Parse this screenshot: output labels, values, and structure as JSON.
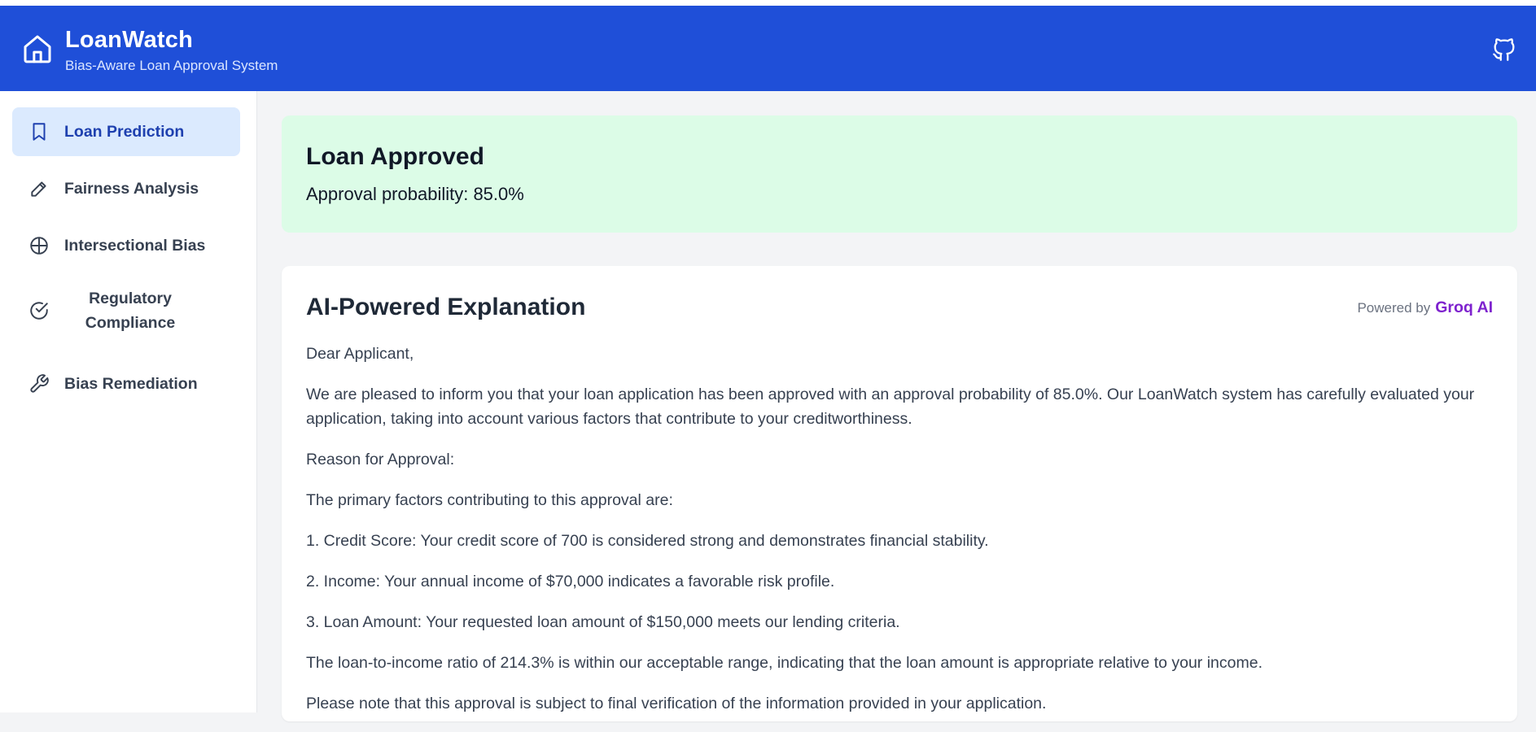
{
  "header": {
    "title": "LoanWatch",
    "subtitle": "Bias-Aware Loan Approval System",
    "home_icon": "home-icon",
    "github_icon": "github-icon",
    "background": "#1f4fd8"
  },
  "sidebar": {
    "items": [
      {
        "label": "Loan Prediction",
        "icon": "bookmark-icon",
        "active": true
      },
      {
        "label": "Fairness Analysis",
        "icon": "pencil-icon",
        "active": false
      },
      {
        "label": "Intersectional Bias",
        "icon": "globe-icon",
        "active": false
      },
      {
        "label": "Regulatory Compliance",
        "icon": "check-circle-icon",
        "active": false
      },
      {
        "label": "Bias Remediation",
        "icon": "wrench-icon",
        "active": false
      }
    ]
  },
  "result": {
    "title": "Loan Approved",
    "probability_text": "Approval probability: 85.0%",
    "color": "#dcfce7"
  },
  "explanation": {
    "title": "AI-Powered Explanation",
    "powered_by": "Powered by",
    "provider": "Groq AI",
    "paragraphs": [
      "Dear Applicant,",
      "We are pleased to inform you that your loan application has been approved with an approval probability of 85.0%. Our LoanWatch system has carefully evaluated your application, taking into account various factors that contribute to your creditworthiness.",
      "Reason for Approval:",
      "The primary factors contributing to this approval are:",
      "1. Credit Score: Your credit score of 700 is considered strong and demonstrates financial stability.",
      "2. Income: Your annual income of $70,000 indicates a favorable risk profile.",
      "3. Loan Amount: Your requested loan amount of $150,000 meets our lending criteria.",
      "The loan-to-income ratio of 214.3% is within our acceptable range, indicating that the loan amount is appropriate relative to your income.",
      "Please note that this approval is subject to final verification of the information provided in your application."
    ]
  }
}
